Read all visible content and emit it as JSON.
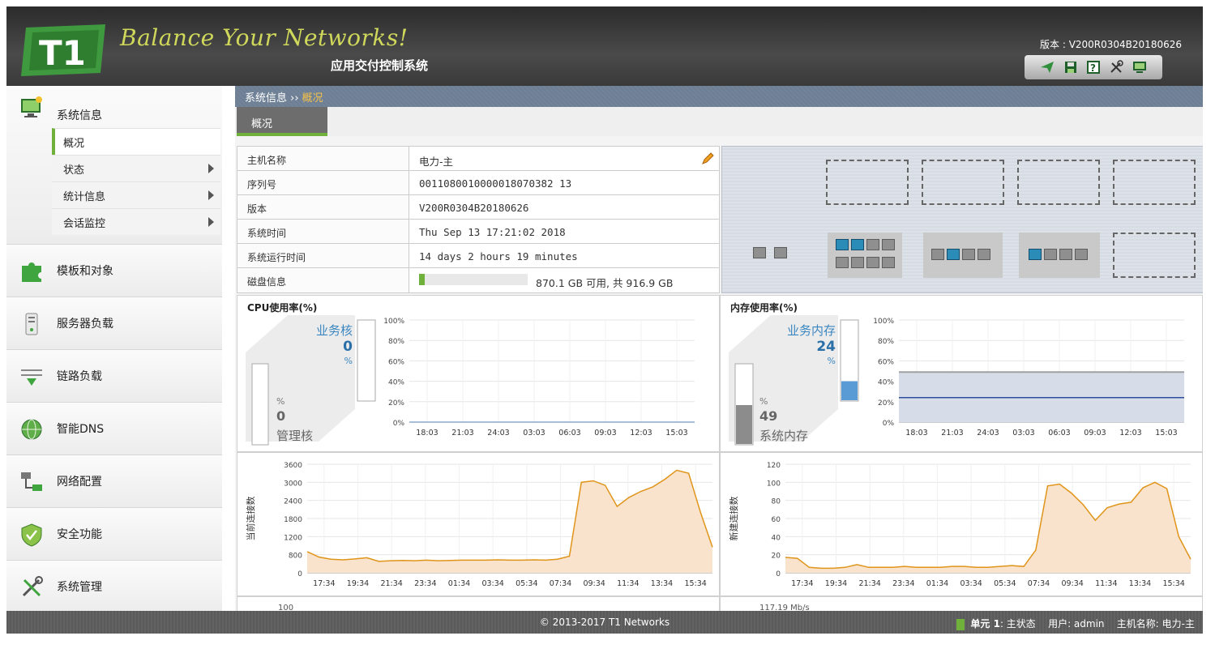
{
  "header": {
    "logo_text": "T1",
    "slogan": "Balance Your Networks!",
    "subtitle": "应用交付控制系统",
    "version": "版本 : V200R0304B20180626",
    "tools": [
      "send-icon",
      "save-icon",
      "help-icon",
      "tools-icon",
      "monitor-icon"
    ]
  },
  "sidebar": {
    "groups": [
      {
        "label": "系统信息",
        "icon": "system-info-icon",
        "sub": [
          {
            "label": "概况",
            "active": true
          },
          {
            "label": "状态",
            "arrow": true
          },
          {
            "label": "统计信息",
            "arrow": true
          },
          {
            "label": "会话监控",
            "arrow": true
          }
        ]
      },
      {
        "label": "模板和对象",
        "icon": "puzzle-icon"
      },
      {
        "label": "服务器负载",
        "icon": "server-icon"
      },
      {
        "label": "链路负载",
        "icon": "link-icon"
      },
      {
        "label": "智能DNS",
        "icon": "globe-icon"
      },
      {
        "label": "网络配置",
        "icon": "network-icon"
      },
      {
        "label": "安全功能",
        "icon": "shield-icon"
      },
      {
        "label": "系统管理",
        "icon": "wrench-icon"
      }
    ]
  },
  "breadcrumb": {
    "parent": "系统信息 ››",
    "current": "概况"
  },
  "tab": "概况",
  "info": [
    {
      "key": "主机名称",
      "value": "电力-主"
    },
    {
      "key": "序列号",
      "value": "0011080010000018070382 13"
    },
    {
      "key": "版本",
      "value": "V200R0304B20180626"
    },
    {
      "key": "系统时间",
      "value": "Thu Sep 13 17:21:02 2018"
    },
    {
      "key": "系统运行时间",
      "value": "14 days 2 hours 19 minutes"
    },
    {
      "key": "磁盘信息",
      "value": "870.1 GB 可用, 共 916.9 GB"
    }
  ],
  "disk_used_fraction": 0.05,
  "cpu": {
    "title": "CPU使用率(%)",
    "business_label": "业务核",
    "business_value": "0",
    "unit": "%",
    "mgmt_label": "管理核",
    "mgmt_value": "0",
    "mgmt_unit": "%",
    "business_fraction": 0.0,
    "mgmt_fraction": 0.0
  },
  "mem": {
    "title": "内存使用率(%)",
    "business_label": "业务内存",
    "business_value": "24",
    "unit": "%",
    "sys_label": "系统内存",
    "sys_value": "49",
    "sys_unit": "%",
    "business_fraction": 0.24,
    "sys_fraction": 0.49
  },
  "chart_data": [
    {
      "type": "line",
      "title": "CPU使用率(%)",
      "x": [
        "18:03",
        "21:03",
        "24:03",
        "03:03",
        "06:03",
        "09:03",
        "12:03",
        "15:03"
      ],
      "ylim": [
        0,
        100
      ],
      "yticks": [
        "100%",
        "80%",
        "60%",
        "40%",
        "20%",
        "0%"
      ],
      "series": [
        {
          "values": [
            0,
            0,
            0,
            0,
            0,
            0,
            0,
            0,
            0
          ]
        }
      ]
    },
    {
      "type": "area",
      "title": "内存使用率(%)",
      "x": [
        "18:03",
        "21:03",
        "24:03",
        "03:03",
        "06:03",
        "09:03",
        "12:03",
        "15:03"
      ],
      "ylim": [
        0,
        100
      ],
      "yticks": [
        "100%",
        "80%",
        "60%",
        "40%",
        "20%",
        "0%"
      ],
      "series": [
        {
          "values": [
            49,
            49,
            49,
            49,
            49,
            49,
            49,
            49,
            49
          ]
        },
        {
          "values": [
            24,
            24,
            24,
            24,
            24,
            24,
            24,
            24,
            24
          ]
        }
      ]
    },
    {
      "type": "area",
      "ylabel": "当前连接数",
      "x": [
        "17:34",
        "19:34",
        "21:34",
        "23:34",
        "01:34",
        "03:34",
        "05:34",
        "07:34",
        "09:34",
        "11:34",
        "13:34",
        "15:34"
      ],
      "ylim": [
        0,
        3600
      ],
      "yticks": [
        "3600",
        "3000",
        "2400",
        "1800",
        "1200",
        "800",
        "0"
      ],
      "series": [
        {
          "values": [
            700,
            520,
            450,
            430,
            460,
            500,
            380,
            400,
            410,
            400,
            420,
            400,
            410,
            420,
            420,
            420,
            430,
            420,
            420,
            430,
            420,
            450,
            550,
            3000,
            3050,
            2900,
            2200,
            2500,
            2700,
            2850,
            3100,
            3400,
            3300,
            2000,
            850
          ]
        }
      ]
    },
    {
      "type": "area",
      "ylabel": "新建连接数",
      "x": [
        "17:34",
        "19:34",
        "21:34",
        "23:34",
        "01:34",
        "03:34",
        "05:34",
        "07:34",
        "09:34",
        "11:34",
        "13:34",
        "15:34"
      ],
      "ylim": [
        0,
        120
      ],
      "yticks": [
        "120",
        "100",
        "80",
        "60",
        "40",
        "20",
        "0"
      ],
      "series": [
        {
          "values": [
            17,
            16,
            6,
            5,
            5,
            6,
            9,
            6,
            6,
            6,
            7,
            6,
            6,
            6,
            7,
            7,
            6,
            6,
            7,
            8,
            7,
            25,
            96,
            98,
            88,
            75,
            58,
            72,
            76,
            78,
            94,
            100,
            93,
            40,
            15
          ]
        }
      ]
    }
  ],
  "partial_labels": {
    "left": "100",
    "right": "117.19 Mb/s"
  },
  "footer": {
    "copyright": "© 2013-2017 T1 Networks",
    "unit": "单元 1",
    "unit_state": ": 主状态",
    "user": "用户: admin",
    "host": "主机名称: 电力-主"
  }
}
